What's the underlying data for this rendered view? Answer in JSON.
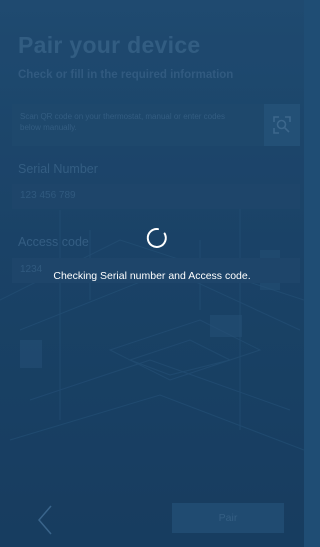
{
  "header": {
    "title": "Pair your device",
    "subtitle": "Check or fill in the required information"
  },
  "scan": {
    "instructions": "Scan QR code on your thermostat, manual or enter codes below manually.",
    "icon": "qr-scan-icon"
  },
  "serial": {
    "label": "Serial Number",
    "value": "123 456 789"
  },
  "access": {
    "label": "Access code",
    "value": "1234"
  },
  "footer": {
    "back_icon": "chevron-left-icon",
    "pair_label": "Pair"
  },
  "overlay": {
    "message": "Checking Serial number and Access code.",
    "spinner_icon": "loading-spinner-icon"
  },
  "colors": {
    "background": "#1f4d74",
    "overlay_text": "#ffffff"
  }
}
